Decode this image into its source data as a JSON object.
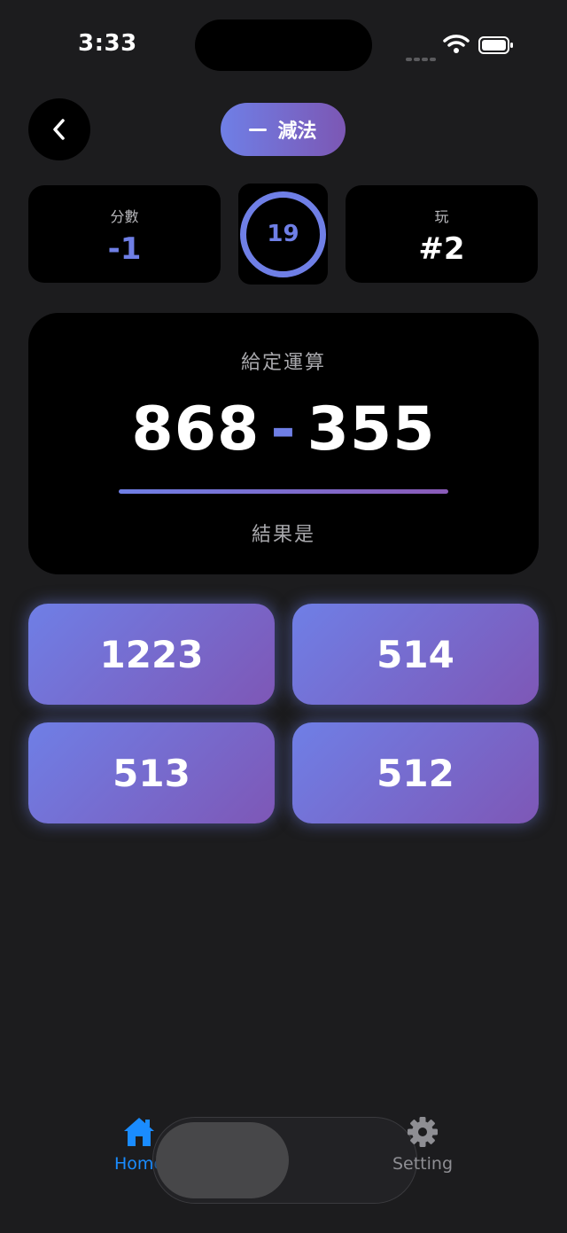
{
  "status_bar": {
    "time": "3:33"
  },
  "header": {
    "mode_label": "減法"
  },
  "stats": {
    "score_caption": "分數",
    "score_value": "-1",
    "timer_value": "19",
    "play_caption": "玩",
    "play_value": "#2"
  },
  "question": {
    "given_label": "給定運算",
    "operand_a": "868",
    "operator": "-",
    "operand_b": "355",
    "result_label": "結果是"
  },
  "answers": [
    "1223",
    "514",
    "513",
    "512"
  ],
  "tab_bar": {
    "tabs": [
      {
        "label": "Home",
        "icon": "house-icon",
        "active": true
      },
      {
        "label": "Setting",
        "icon": "gear-icon",
        "active": false
      }
    ]
  },
  "colors": {
    "accent": "#6f7fe6",
    "accent_end": "#7c57b4",
    "active_tab": "#1a8cff",
    "background": "#1c1c1e"
  }
}
